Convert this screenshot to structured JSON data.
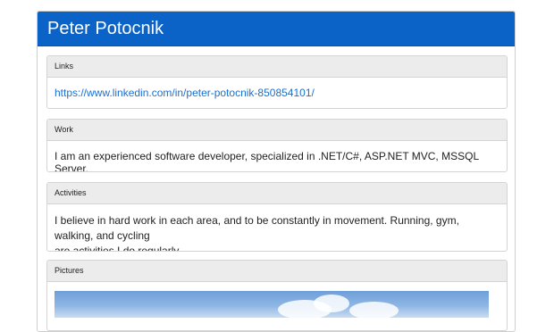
{
  "header": {
    "title": "Peter Potocnik"
  },
  "sections": [
    {
      "heading": "Links",
      "link_text": "https://www.linkedin.com/in/peter-potocnik-850854101/"
    },
    {
      "heading": "Work",
      "text": "I am an experienced software developer, specialized in .NET/C#, ASP.NET MVC, MSSQL Server."
    },
    {
      "heading": "Activities",
      "text_line1": "I believe in hard work in each area, and to be constantly in movement. Running, gym, walking, and cycling",
      "text_line2": "are activities I do regularly."
    },
    {
      "heading": "Pictures"
    }
  ],
  "colors": {
    "header_bg": "#0b63c8",
    "panel_heading_bg": "#ececec",
    "link": "#1a6fd1"
  }
}
